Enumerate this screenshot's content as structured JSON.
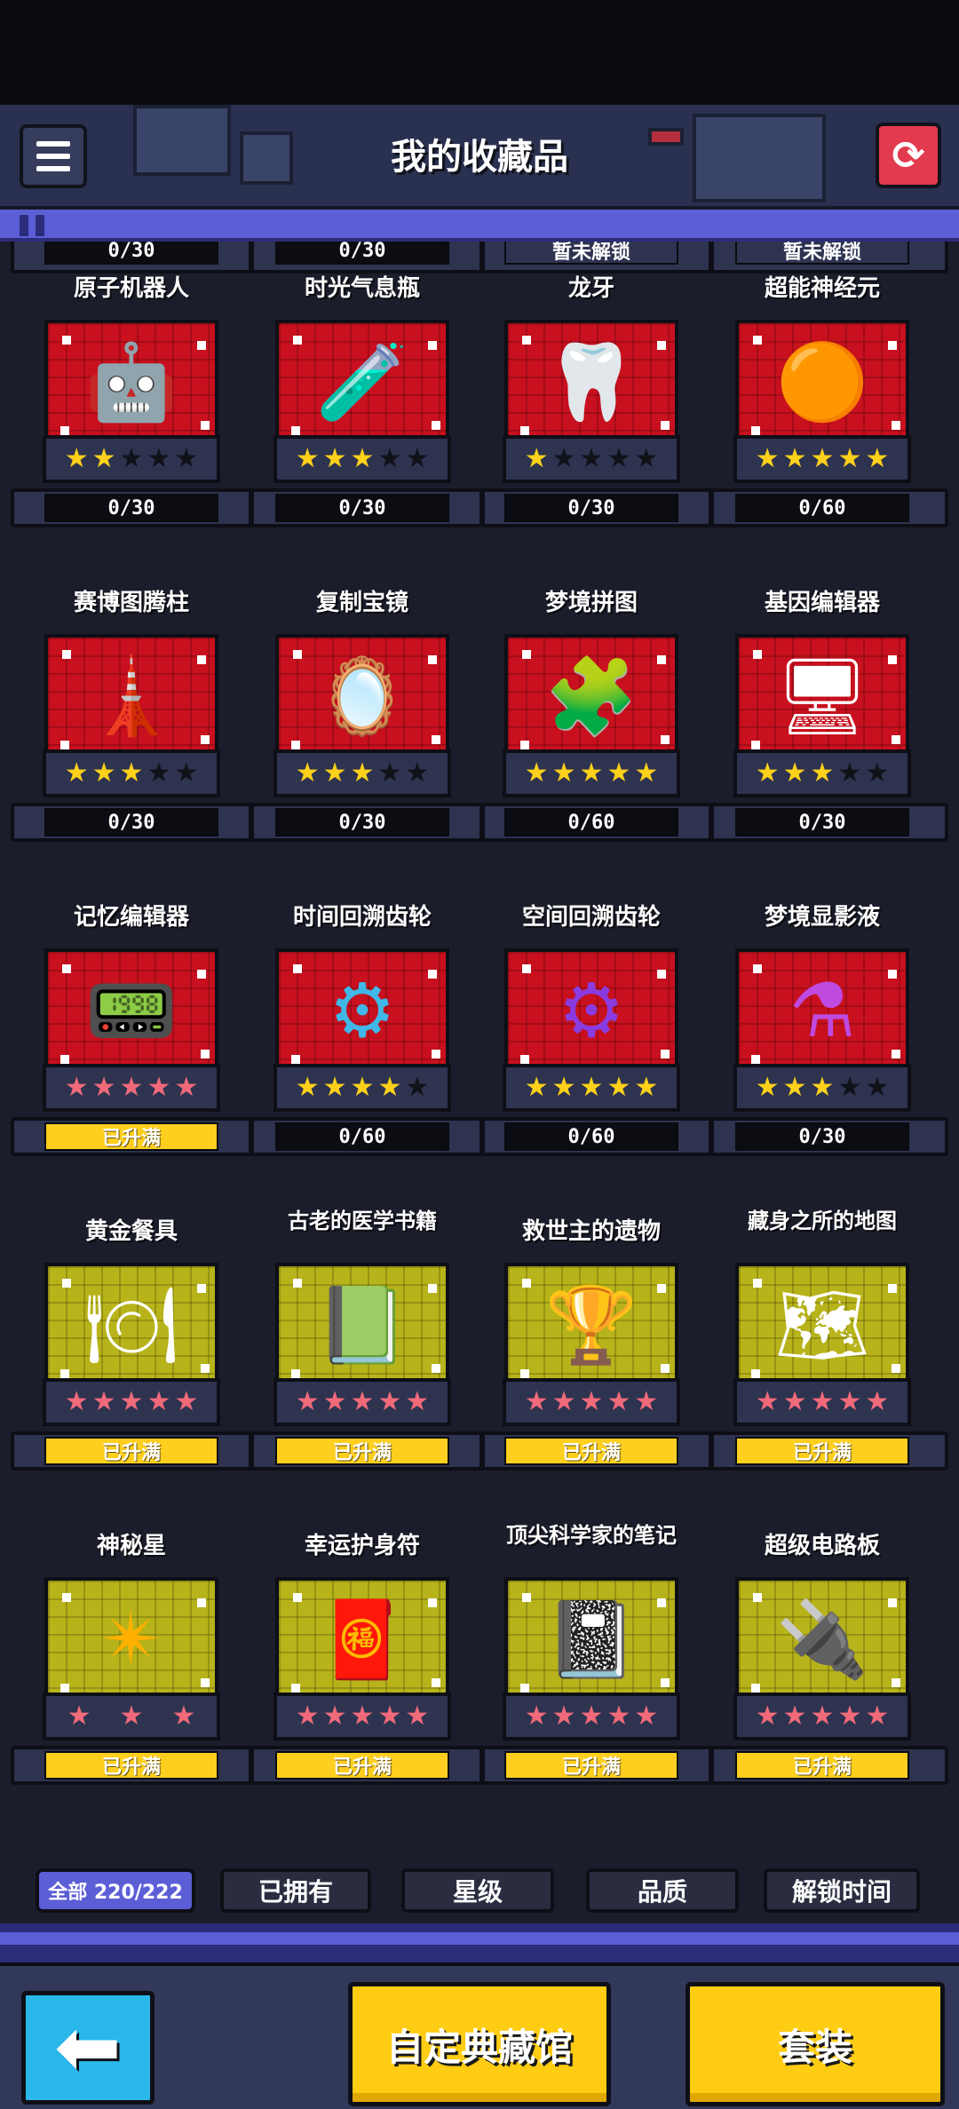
{
  "header": {
    "title": "我的收藏品",
    "menu_icon": "list-icon",
    "refresh_icon": "refresh-icon"
  },
  "top_partial_row": [
    {
      "progress": "0/30"
    },
    {
      "progress": "0/30"
    },
    {
      "progress": "暂未解锁"
    },
    {
      "progress": "暂未解锁"
    }
  ],
  "collection": [
    {
      "name": "原子机器人",
      "stars": 2,
      "max_stars": 5,
      "rarity": "red",
      "progress": "0/30",
      "maxed": false,
      "icon": "robot-icon"
    },
    {
      "name": "时光气息瓶",
      "stars": 3,
      "max_stars": 5,
      "rarity": "red",
      "progress": "0/30",
      "maxed": false,
      "icon": "potion-bottle-icon"
    },
    {
      "name": "龙牙",
      "stars": 1,
      "max_stars": 5,
      "rarity": "red",
      "progress": "0/30",
      "maxed": false,
      "icon": "dragon-tooth-icon"
    },
    {
      "name": "超能神经元",
      "stars": 5,
      "max_stars": 5,
      "rarity": "red",
      "progress": "0/60",
      "maxed": false,
      "icon": "neuron-icon"
    },
    {
      "name": "赛博图腾柱",
      "stars": 3,
      "max_stars": 5,
      "rarity": "red",
      "progress": "0/30",
      "maxed": false,
      "icon": "totem-icon"
    },
    {
      "name": "复制宝镜",
      "stars": 3,
      "max_stars": 5,
      "rarity": "red",
      "progress": "0/30",
      "maxed": false,
      "icon": "mirror-icon"
    },
    {
      "name": "梦境拼图",
      "stars": 5,
      "max_stars": 5,
      "rarity": "red",
      "progress": "0/60",
      "maxed": false,
      "icon": "puzzle-icon"
    },
    {
      "name": "基因编辑器",
      "stars": 3,
      "max_stars": 5,
      "rarity": "red",
      "progress": "0/30",
      "maxed": false,
      "icon": "gene-editor-icon"
    },
    {
      "name": "记忆编辑器",
      "stars": 5,
      "max_stars": 5,
      "rarity": "red",
      "progress": "已升满",
      "maxed": true,
      "icon": "memory-device-icon"
    },
    {
      "name": "时间回溯齿轮",
      "stars": 4,
      "max_stars": 5,
      "rarity": "red",
      "progress": "0/60",
      "maxed": false,
      "icon": "gear-icon"
    },
    {
      "name": "空间回溯齿轮",
      "stars": 5,
      "max_stars": 5,
      "rarity": "red",
      "progress": "0/60",
      "maxed": false,
      "icon": "purple-gear-icon"
    },
    {
      "name": "梦境显影液",
      "stars": 3,
      "max_stars": 5,
      "rarity": "red",
      "progress": "0/30",
      "maxed": false,
      "icon": "flask-icon"
    },
    {
      "name": "黄金餐具",
      "stars": 5,
      "max_stars": 5,
      "rarity": "gold",
      "progress": "已升满",
      "maxed": true,
      "icon": "golden-cutlery-icon"
    },
    {
      "name": "古老的医学书籍",
      "stars": 5,
      "max_stars": 5,
      "rarity": "gold",
      "progress": "已升满",
      "maxed": true,
      "icon": "medical-book-icon"
    },
    {
      "name": "救世主的遗物",
      "stars": 5,
      "max_stars": 5,
      "rarity": "gold",
      "progress": "已升满",
      "maxed": true,
      "icon": "chalice-icon"
    },
    {
      "name": "藏身之所的地图",
      "stars": 5,
      "max_stars": 5,
      "rarity": "gold",
      "progress": "已升满",
      "maxed": true,
      "icon": "map-icon"
    },
    {
      "name": "神秘星",
      "stars": 3,
      "max_stars": 3,
      "rarity": "gold",
      "progress": "已升满",
      "maxed": true,
      "icon": "mystery-star-icon"
    },
    {
      "name": "幸运护身符",
      "stars": 5,
      "max_stars": 5,
      "rarity": "gold",
      "progress": "已升满",
      "maxed": true,
      "icon": "amulet-icon"
    },
    {
      "name": "顶尖科学家的笔记",
      "stars": 5,
      "max_stars": 5,
      "rarity": "gold",
      "progress": "已升满",
      "maxed": true,
      "icon": "notebook-icon"
    },
    {
      "name": "超级电路板",
      "stars": 5,
      "max_stars": 5,
      "rarity": "gold",
      "progress": "已升满",
      "maxed": true,
      "icon": "circuit-board-icon"
    }
  ],
  "filters": {
    "all_label": "全部 220/222",
    "owned": "已拥有",
    "star": "星级",
    "quality": "品质",
    "unlock_time": "解锁时间"
  },
  "bottom": {
    "back_icon": "back-arrow-icon",
    "custom_hall": "自定典藏馆",
    "set": "套装"
  },
  "colors": {
    "accent_purple": "#5c5ed6",
    "rarity_red": "#c8101e",
    "rarity_gold": "#b7b31a",
    "button_gold": "#ffcc14",
    "star_gold": "#ffd11a",
    "star_pink": "#f06a7a"
  }
}
